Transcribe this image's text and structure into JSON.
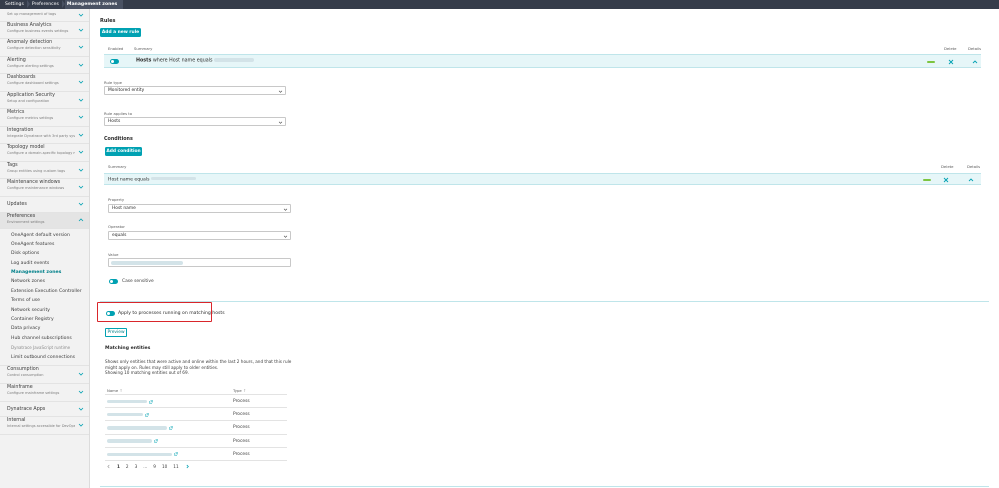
{
  "breadcrumb": [
    "Settings",
    "Preferences",
    "Management zones"
  ],
  "sidebar": {
    "top_partial_sub": "Set up management of tags",
    "items": [
      {
        "title": "Business Analytics",
        "sub": "Configure business events settings"
      },
      {
        "title": "Anomaly detection",
        "sub": "Configure detection sensitivity"
      },
      {
        "title": "Alerting",
        "sub": "Configure alerting settings"
      },
      {
        "title": "Dashboards",
        "sub": "Configure dashboard settings"
      },
      {
        "title": "Application Security",
        "sub": "Setup and configuration"
      },
      {
        "title": "Metrics",
        "sub": "Configure metrics settings"
      },
      {
        "title": "Integration",
        "sub": "Integrate Dynatrace with 3rd party systems"
      },
      {
        "title": "Topology model",
        "sub": "Configure a domain-specific topology model"
      },
      {
        "title": "Tags",
        "sub": "Group entities using custom tags"
      },
      {
        "title": "Maintenance windows",
        "sub": "Configure maintenance windows"
      },
      {
        "title": "Updates",
        "sub": ""
      }
    ],
    "open": {
      "title": "Preferences",
      "sub": "Environment settings"
    },
    "subitems": [
      "OneAgent default version",
      "OneAgent features",
      "Disk options",
      "Log audit events",
      "Management zones",
      "Network zones",
      "Extension Execution Controller",
      "Terms of use",
      "Network security",
      "Container Registry",
      "Data privacy",
      "Hub channel subscriptions",
      "Dynatrace JavaScript runtime",
      "Limit outbound connections"
    ],
    "active_subitem": "Management zones",
    "after_items": [
      {
        "title": "Consumption",
        "sub": "Control consumption"
      },
      {
        "title": "Mainframe",
        "sub": "Configure mainframe settings"
      },
      {
        "title": "Dynatrace Apps",
        "sub": ""
      },
      {
        "title": "Internal",
        "sub": "Internal settings accessible for DevOps"
      }
    ]
  },
  "rules": {
    "heading": "Rules",
    "add_button": "Add a new rule",
    "col_enabled": "Enabled",
    "col_summary": "Summary",
    "col_delete": "Delete",
    "col_details": "Details",
    "summary_entity": "Hosts",
    "summary_rest": "where Host name equals",
    "rule_type_label": "Rule type",
    "rule_type_value": "Monitored entity",
    "rule_applies_label": "Rule applies to",
    "rule_applies_value": "Hosts"
  },
  "conditions": {
    "heading": "Conditions",
    "add_button": "Add condition",
    "col_summary": "Summary",
    "col_delete": "Delete",
    "col_details": "Details",
    "row_summary": "Host name equals",
    "property_label": "Property",
    "property_value": "Host name",
    "operator_label": "Operator",
    "operator_value": "equals",
    "value_label": "Value",
    "case_sensitive_label": "Case sensitive"
  },
  "apply_to_processes_label": "Apply to processes running on matching hosts",
  "preview_button": "Preview",
  "matching": {
    "heading": "Matching entities",
    "desc_line1": "Shows only entities that were active and online within the last 2 hours, and that this rule",
    "desc_line2": "might apply on. Rules may still apply to older entities.",
    "desc_line3": "Showing 10 matching entities out of 69.",
    "col_name": "Name",
    "col_type": "Type",
    "rows": [
      {
        "type": "Process"
      },
      {
        "type": "Process"
      },
      {
        "type": "Process"
      },
      {
        "type": "Process"
      },
      {
        "type": "Process"
      }
    ],
    "pages": [
      "1",
      "2",
      "3",
      "...",
      "9",
      "10",
      "11"
    ],
    "current_page": "1"
  },
  "colors": {
    "accent": "#00a1b2",
    "highlight_row": "#e6f6f8",
    "top_bar": "#353c4a",
    "annotation_red": "#d9262b"
  }
}
